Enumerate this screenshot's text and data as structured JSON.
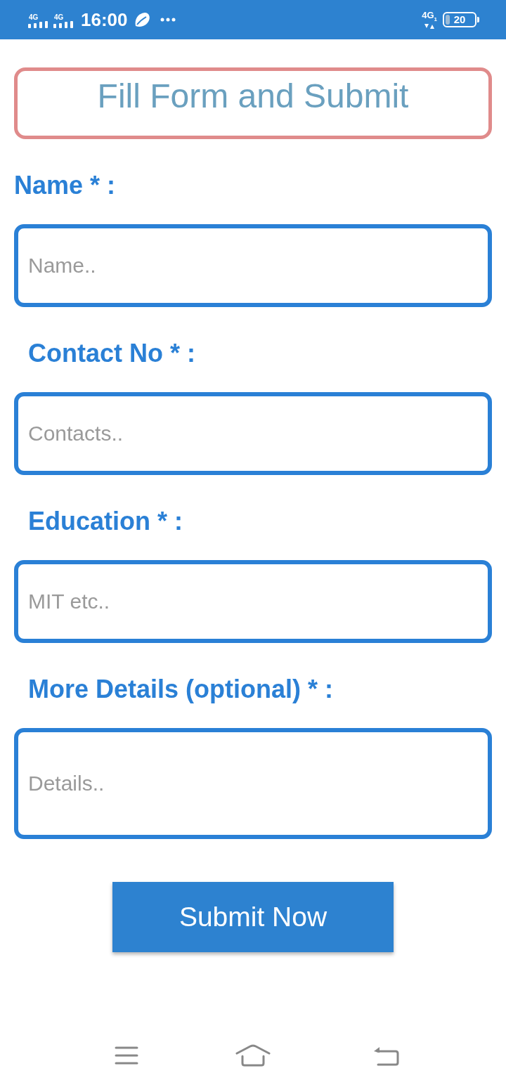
{
  "status_bar": {
    "sim_1_network": "4G",
    "sim_2_network": "4G",
    "time": "16:00",
    "data_network": "4G$_{1}$",
    "battery": "20"
  },
  "title": "Fill Form and Submit",
  "fields": [
    {
      "label": "Name * :",
      "placeholder": "Name..",
      "kind": "single"
    },
    {
      "label": "Contact No * :",
      "placeholder": "Contacts..",
      "kind": "single"
    },
    {
      "label": "Education * :",
      "placeholder": "MIT etc..",
      "kind": "single"
    },
    {
      "label": "More Details (optional) * :",
      "placeholder": "Details..",
      "kind": "multi"
    }
  ],
  "submit_button": "Submit Now"
}
